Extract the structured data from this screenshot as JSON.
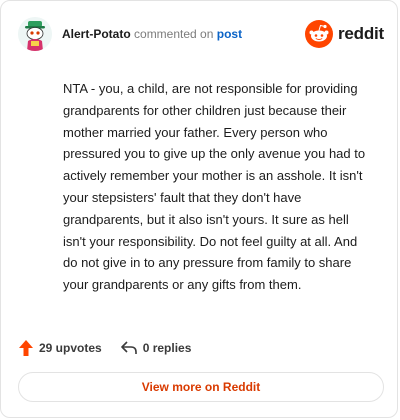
{
  "header": {
    "username": "Alert-Potato",
    "action_text": "commented on",
    "post_link": "post",
    "brand_name": "reddit"
  },
  "comment": {
    "text": "NTA - you, a child, are not responsible for providing grandparents for other children just because their mother married your father. Every person who pressured you to give up the only avenue you had to actively remember your mother is an asshole. It isn't your stepsisters' fault that they don't have grandparents, but it also isn't yours. It sure as hell isn't your responsibility. Do not feel guilty at all. And do not give in to any pressure from family to share your grandparents or any gifts from them."
  },
  "actions": {
    "upvotes": "29 upvotes",
    "replies": "0 replies"
  },
  "footer": {
    "view_more": "View more on Reddit"
  },
  "icons": {
    "avatar": "snoo-avatar-icon",
    "brand": "reddit-logo-icon",
    "upvote": "upvote-arrow-icon",
    "reply": "reply-arrow-icon"
  },
  "colors": {
    "brand_orange": "#ff4500",
    "link_blue": "#0a63c7",
    "view_more_text": "#d93a00",
    "upvote_arrow": "#ff4500"
  }
}
